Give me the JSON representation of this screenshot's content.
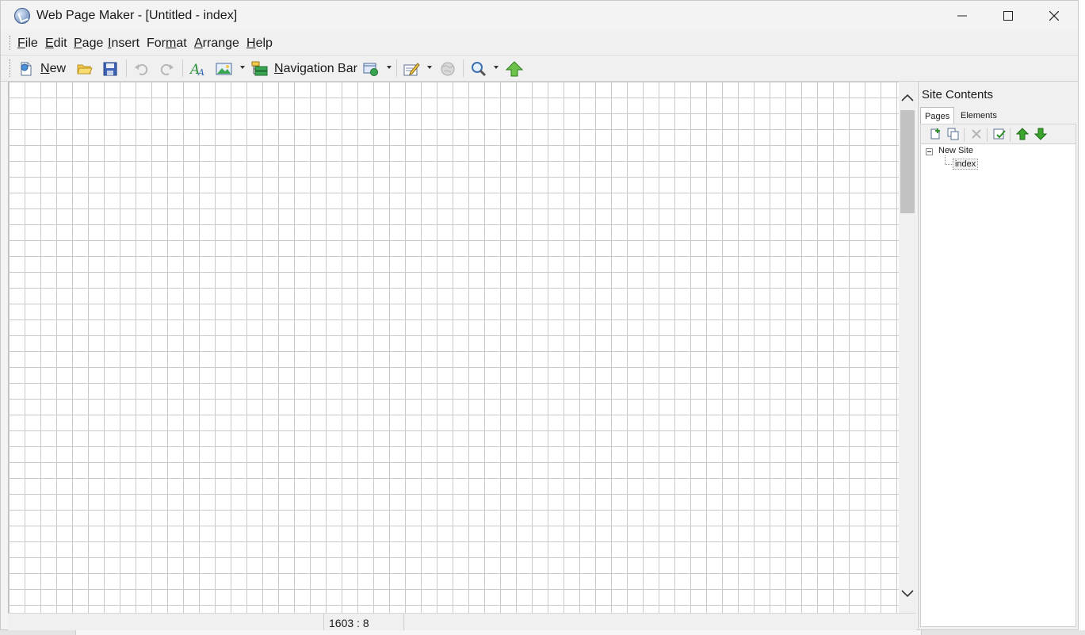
{
  "window": {
    "title": "Web Page Maker - [Untitled - index]"
  },
  "menubar": {
    "items": [
      {
        "pre": "",
        "u": "F",
        "post": "ile"
      },
      {
        "pre": "",
        "u": "E",
        "post": "dit"
      },
      {
        "pre": "",
        "u": "P",
        "post": "age"
      },
      {
        "pre": "",
        "u": "I",
        "post": "nsert"
      },
      {
        "pre": "For",
        "u": "m",
        "post": "at"
      },
      {
        "pre": "",
        "u": "A",
        "post": "rrange"
      },
      {
        "pre": "",
        "u": "H",
        "post": "elp"
      }
    ]
  },
  "toolbar": {
    "new_u": "N",
    "new_rest": "ew",
    "navbar_u": "N",
    "navbar_rest": "avigation Bar",
    "icons": [
      "new-page-icon",
      "open-folder-icon",
      "save-icon",
      "undo-icon",
      "redo-icon",
      "text-icon",
      "image-icon",
      "navigation-bar-icon",
      "insert-object-icon",
      "edit-icon",
      "preview-icon",
      "zoom-icon",
      "publish-icon"
    ]
  },
  "status": {
    "coords": "1603 : 8"
  },
  "panel": {
    "title": "Site Contents",
    "tabs": [
      "Pages",
      "Elements"
    ],
    "active_tab": "Pages",
    "tree": {
      "root": "New Site",
      "children": [
        "index"
      ]
    }
  },
  "colors": {
    "grid_line": "#c9c9c9",
    "chrome": "#f0f0f0",
    "accent_green": "#3aa52a"
  }
}
